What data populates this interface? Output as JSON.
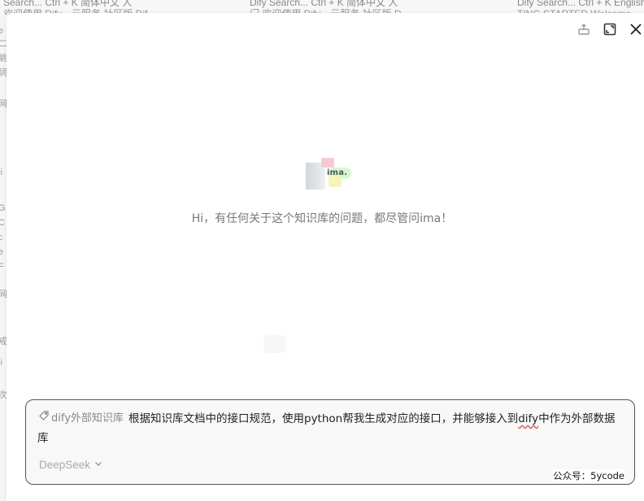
{
  "background": {
    "tabs": [
      {
        "line1": "Search... Ctrl + K 简体中文 人",
        "line2": "欢迎使用 Dify，云服务 社区版 Dif"
      },
      {
        "line1": "Dify Search... Ctrl + K 简体中文 人",
        "line2": "门 欢迎使用 Dify，云服务 社区版 D"
      },
      {
        "line1": "Dify Search... Ctrl + K English",
        "line2": "TING STARTED Welcome"
      }
    ],
    "left_fragments": [
      "e",
      "二",
      "眺",
      "詞",
      "网",
      "i",
      "li",
      "G",
      "C",
      "c",
      "e",
      "F",
      "网",
      "戒",
      "li",
      "次"
    ]
  },
  "modal": {
    "brand_text": "ima.",
    "greeting": "Hi，有任何关于这个知识库的问题，都尽管问ima！",
    "chat": {
      "knowledge_base_tag": "dify外部知识库",
      "prompt_part1": "根据知识库文档中的接口规范，使用python帮我生成对应的接口，并能够接入到",
      "prompt_misspelled": "dify",
      "prompt_part2": "中作为外部数据库",
      "model": "DeepSeek"
    },
    "watermark": "公众号：5ycode"
  },
  "icons": {
    "share": "share-icon",
    "expand": "expand-icon",
    "close": "close-icon",
    "tag": "tag-icon",
    "chevron": "chevron-down-icon"
  }
}
